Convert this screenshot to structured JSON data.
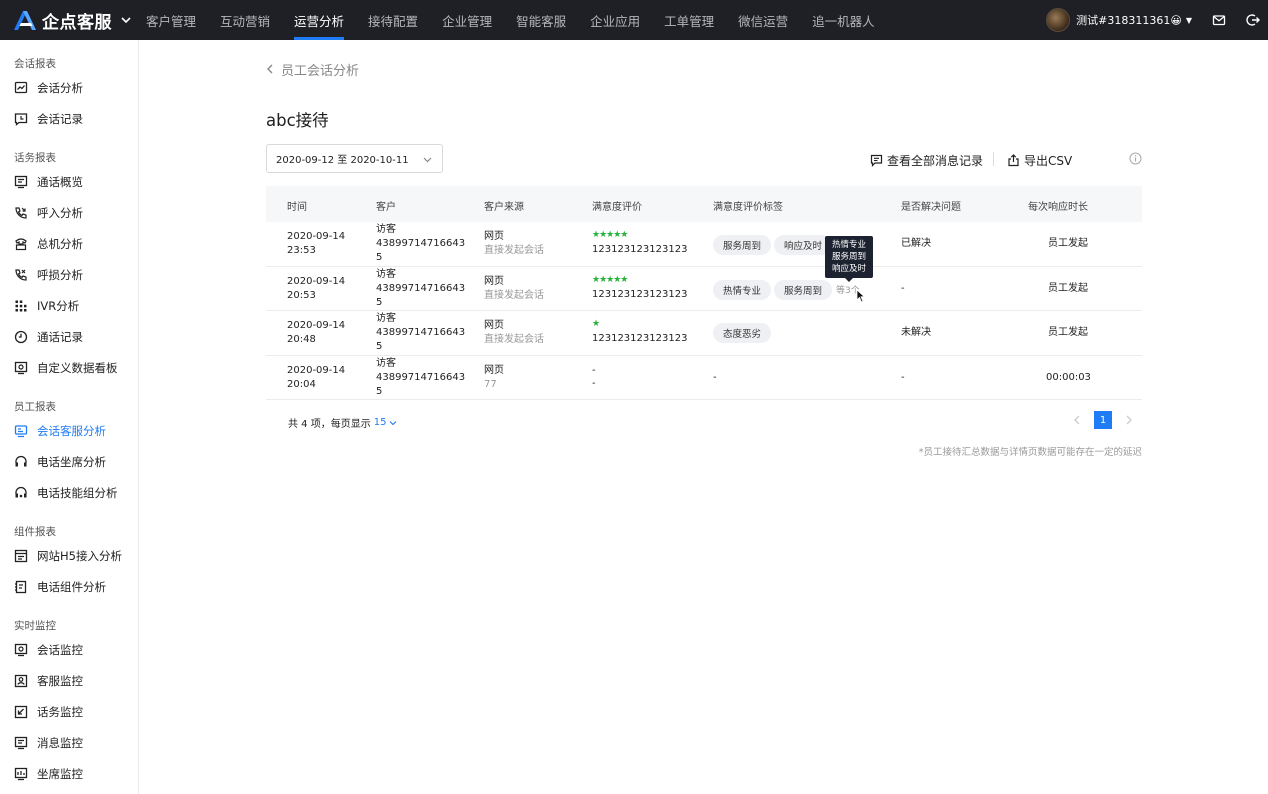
{
  "header": {
    "brand": "企点客服",
    "nav": [
      "客户管理",
      "互动营销",
      "运营分析",
      "接待配置",
      "企业管理",
      "智能客服",
      "企业应用",
      "工单管理",
      "微信运营",
      "追一机器人"
    ],
    "active_nav": "运营分析",
    "user": "测试#318311361😀"
  },
  "sidebar": {
    "sections": [
      {
        "title": "会话报表",
        "items": [
          {
            "label": "会话分析",
            "icon": "chart-line-icon"
          },
          {
            "label": "会话记录",
            "icon": "chat-record-icon"
          }
        ]
      },
      {
        "title": "话务报表",
        "items": [
          {
            "label": "通话概览",
            "icon": "overview-icon"
          },
          {
            "label": "呼入分析",
            "icon": "phone-incoming-icon"
          },
          {
            "label": "总机分析",
            "icon": "switchboard-icon"
          },
          {
            "label": "呼损分析",
            "icon": "phone-missed-icon"
          },
          {
            "label": "IVR分析",
            "icon": "ivr-grid-icon"
          },
          {
            "label": "通话记录",
            "icon": "clock-icon"
          },
          {
            "label": "自定义数据看板",
            "icon": "dashboard-icon"
          }
        ]
      },
      {
        "title": "员工报表",
        "items": [
          {
            "label": "会话客服分析",
            "icon": "chat-agent-icon",
            "active": true
          },
          {
            "label": "电话坐席分析",
            "icon": "headset-icon"
          },
          {
            "label": "电话技能组分析",
            "icon": "headset-group-icon"
          }
        ]
      },
      {
        "title": "组件报表",
        "items": [
          {
            "label": "网站H5接入分析",
            "icon": "web-widget-icon"
          },
          {
            "label": "电话组件分析",
            "icon": "phone-widget-icon"
          }
        ]
      },
      {
        "title": "实时监控",
        "items": [
          {
            "label": "会话监控",
            "icon": "session-monitor-icon"
          },
          {
            "label": "客服监控",
            "icon": "agent-monitor-icon"
          },
          {
            "label": "话务监控",
            "icon": "call-monitor-icon"
          },
          {
            "label": "消息监控",
            "icon": "message-monitor-icon"
          },
          {
            "label": "坐席监控",
            "icon": "seat-monitor-icon"
          }
        ]
      }
    ]
  },
  "page": {
    "back_label": "员工会话分析",
    "title": "abc接待",
    "date_range": "2020-09-12 至 2020-10-11",
    "view_all_label": "查看全部消息记录",
    "export_label": "导出CSV"
  },
  "table": {
    "headers": [
      "时间",
      "客户",
      "客户来源",
      "满意度评价",
      "满意度评价标签",
      "是否解决问题",
      "每次响应时长"
    ],
    "rows": [
      {
        "date": "2020-09-14",
        "time": "23:53",
        "customer": [
          "访客",
          "43899714716643",
          "5"
        ],
        "source": "网页",
        "source_sub": "直接发起会话",
        "stars": "★★★★★",
        "rating_text": "123123123123123",
        "tags": [
          "服务周到",
          "响应及时"
        ],
        "more": "",
        "resolved": "已解决",
        "response": "员工发起"
      },
      {
        "date": "2020-09-14",
        "time": "20:53",
        "customer": [
          "访客",
          "43899714716643",
          "5"
        ],
        "source": "网页",
        "source_sub": "直接发起会话",
        "stars": "★★★★★",
        "rating_text": "123123123123123",
        "tags": [
          "热情专业",
          "服务周到"
        ],
        "more": "等3个",
        "resolved": "-",
        "response": "员工发起"
      },
      {
        "date": "2020-09-14",
        "time": "20:48",
        "customer": [
          "访客",
          "43899714716643",
          "5"
        ],
        "source": "网页",
        "source_sub": "直接发起会话",
        "stars": "★",
        "rating_text": "123123123123123",
        "tags": [
          "态度恶劣"
        ],
        "more": "",
        "resolved": "未解决",
        "response": "员工发起"
      },
      {
        "date": "2020-09-14",
        "time": "20:04",
        "customer": [
          "访客",
          "43899714716643",
          "5"
        ],
        "source": "网页",
        "source_sub": "77",
        "stars": "-",
        "rating_text": "-",
        "tags": [],
        "tags_empty": "-",
        "more": "",
        "resolved": "-",
        "response": "00:00:03"
      }
    ]
  },
  "tooltip": {
    "lines": [
      "热情专业",
      "服务周到",
      "响应及时"
    ]
  },
  "footer": {
    "count_text": "共 4 项，每页显示",
    "page_size": "15",
    "current_page": "1",
    "note": "*员工接待汇总数据与详情页数据可能存在一定的延迟"
  },
  "colors": {
    "accent": "#1f7cf5",
    "topbar": "#1f2026",
    "star": "#25b33c"
  }
}
